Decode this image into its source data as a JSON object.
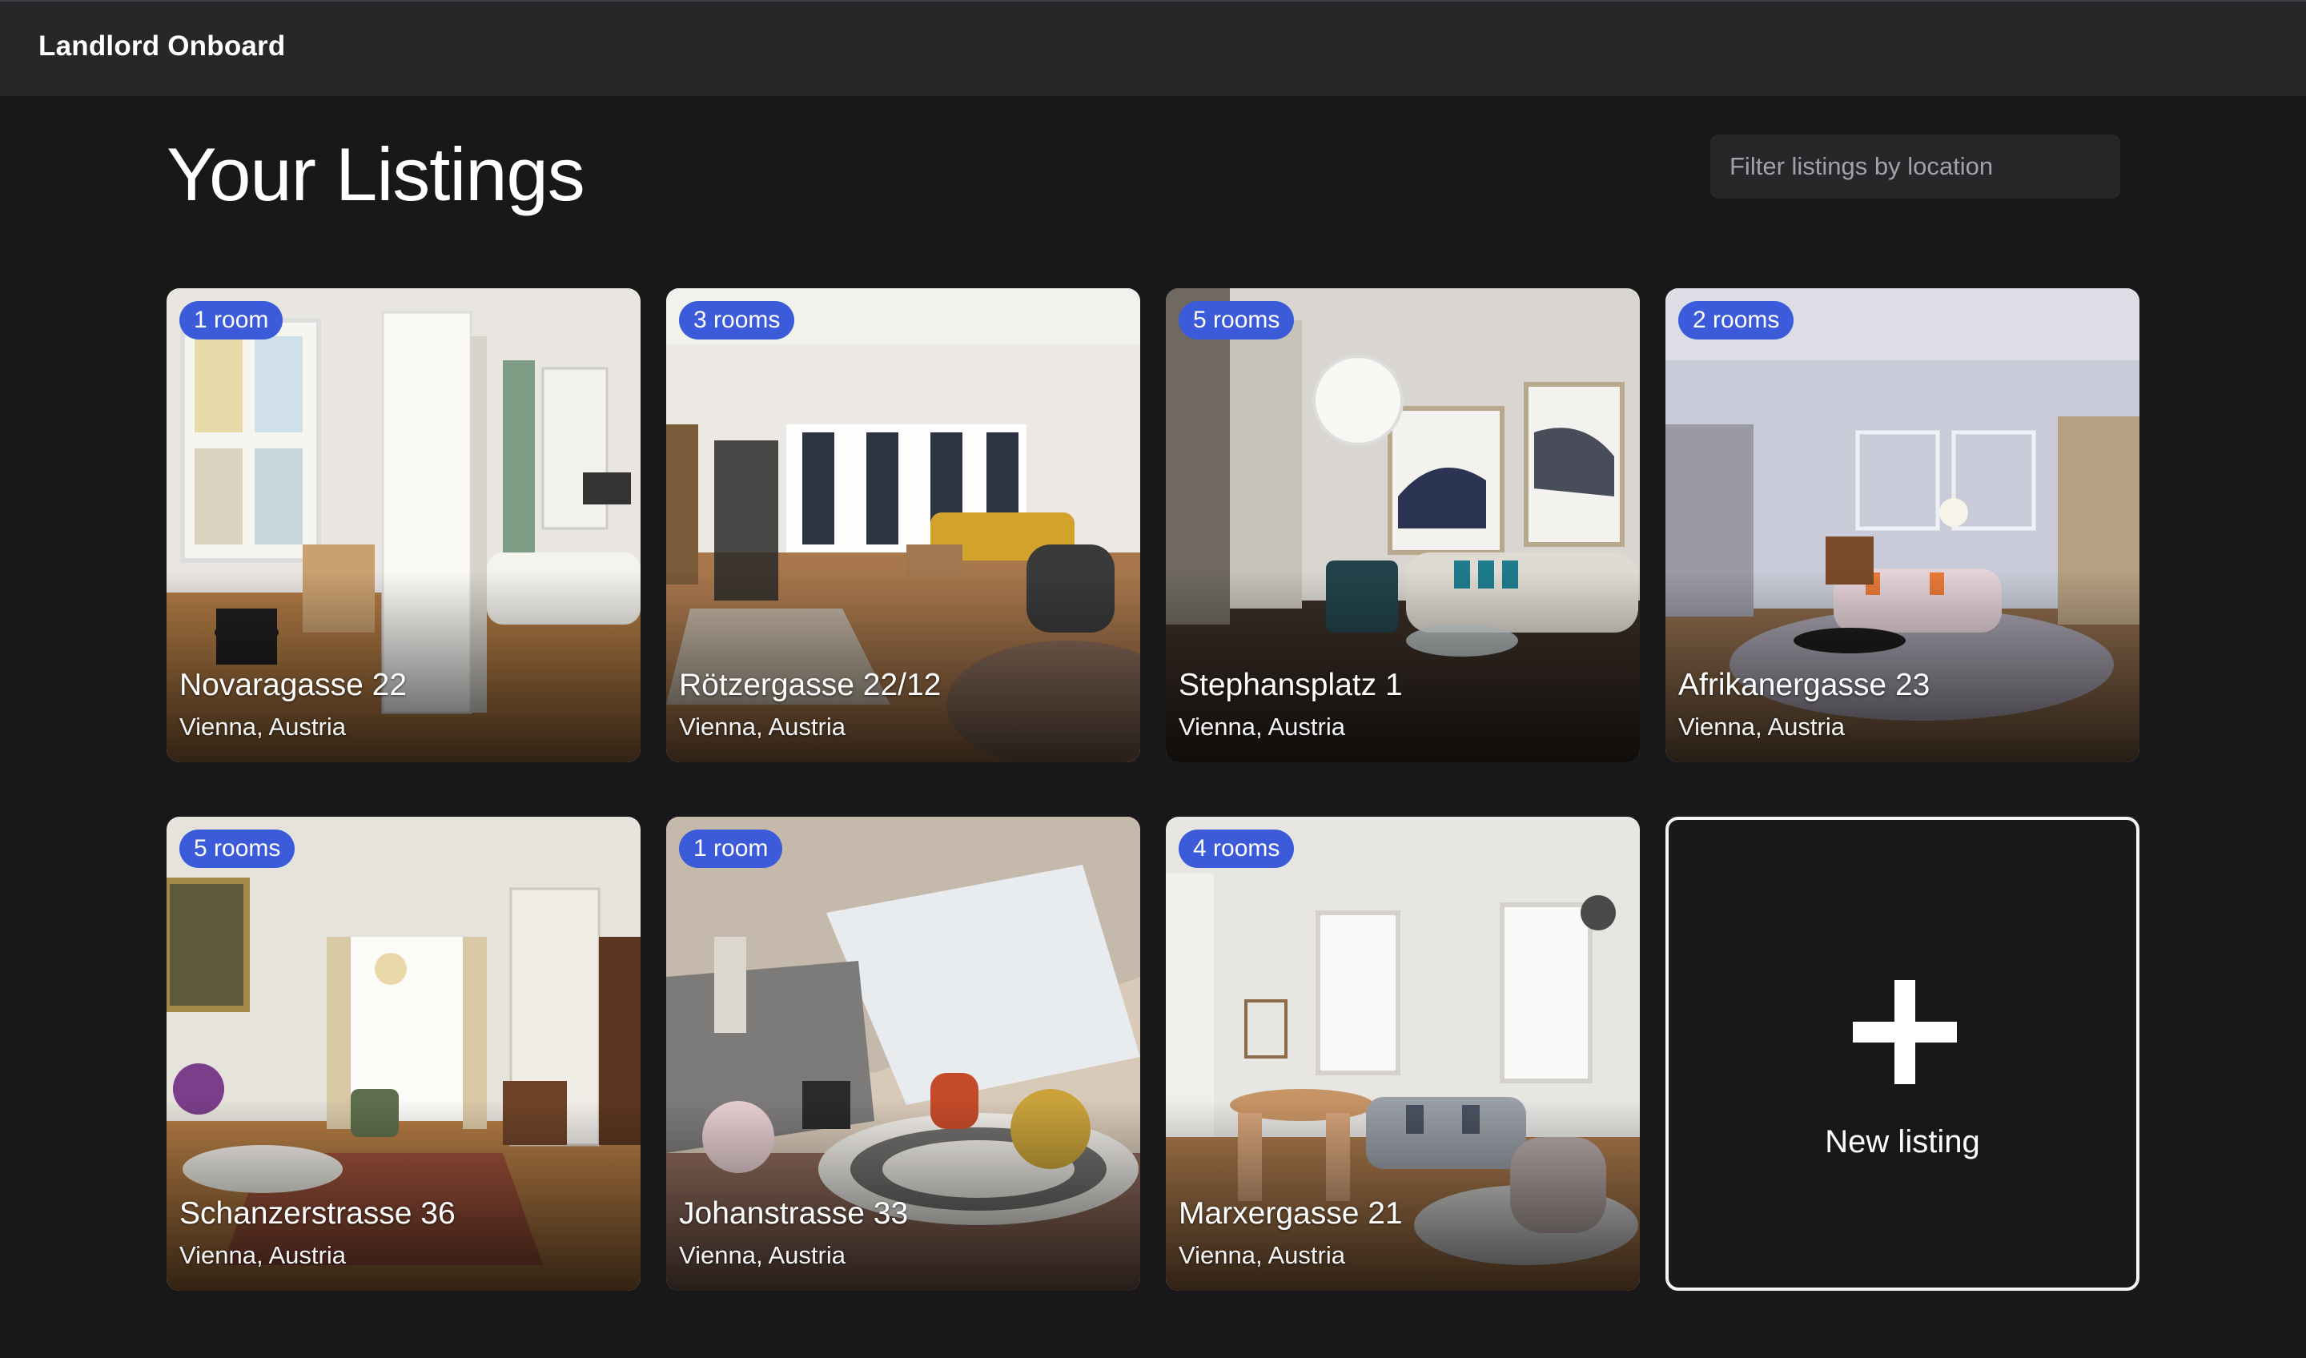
{
  "app": {
    "brand": "Landlord Onboard"
  },
  "page": {
    "title": "Your Listings"
  },
  "filter": {
    "placeholder": "Filter listings by location"
  },
  "listings": [
    {
      "rooms": "1 room",
      "name": "Novaragasse 22",
      "location": "Vienna, Austria"
    },
    {
      "rooms": "3 rooms",
      "name": "Rötzergasse 22/12",
      "location": "Vienna, Austria"
    },
    {
      "rooms": "5 rooms",
      "name": "Stephansplatz 1",
      "location": "Vienna, Austria"
    },
    {
      "rooms": "2 rooms",
      "name": "Afrikanergasse 23",
      "location": "Vienna, Austria"
    },
    {
      "rooms": "5 rooms",
      "name": "Schanzerstrasse 36",
      "location": "Vienna, Austria"
    },
    {
      "rooms": "1 room",
      "name": "Johanstrasse 33",
      "location": "Vienna, Austria"
    },
    {
      "rooms": "4 rooms",
      "name": "Marxergasse 21",
      "location": "Vienna, Austria"
    }
  ],
  "new_listing": {
    "label": "New listing",
    "icon": "plus-icon"
  },
  "colors": {
    "background": "#18181b",
    "topbar": "#27272a",
    "badge": "#3b5bdb"
  }
}
